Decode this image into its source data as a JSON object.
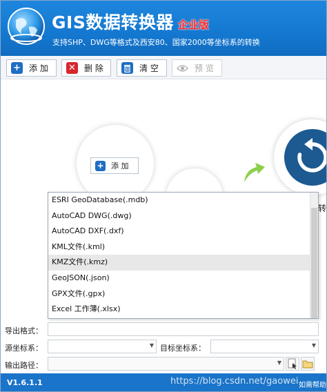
{
  "header": {
    "title": "GIS数据转换器",
    "edition": "企业版",
    "subtitle": "支持SHP、DWG等格式及西安80、国家2000等坐标系的转换"
  },
  "toolbar": {
    "add_label": "添 加",
    "delete_label": "删 除",
    "clear_label": "清 空",
    "preview_label": "预 览"
  },
  "canvas": {
    "add_label": "添 加",
    "convert_label": "转"
  },
  "dropdown": {
    "items": [
      "ESRI GeoDatabase(.mdb)",
      "AutoCAD DWG(.dwg)",
      "AutoCAD DXF(.dxf)",
      "KML文件(.kml)",
      "KMZ文件(.kmz)",
      "GeoJSON(.json)",
      "GPX文件(.gpx)",
      "Excel 工作薄(.xlsx)"
    ],
    "highlighted_index": 4
  },
  "form": {
    "export_format_label": "导出格式：",
    "export_format_value": "",
    "source_crs_label": "源坐标系：",
    "source_crs_value": "",
    "target_crs_label": "目标坐标系：",
    "target_crs_value": "",
    "output_path_label": "输出路径：",
    "output_path_value": ""
  },
  "status": {
    "version": "V1.6.1.1",
    "watermark": "https://blog.csdn.net/gaowei",
    "help": "如需帮助"
  },
  "colors": {
    "header_blue": "#1478d0",
    "edition_red": "#ff2424",
    "status_blue": "#1a74c9",
    "convert_button": "#1c5a91",
    "arrow_green": "#8ccf4a"
  }
}
